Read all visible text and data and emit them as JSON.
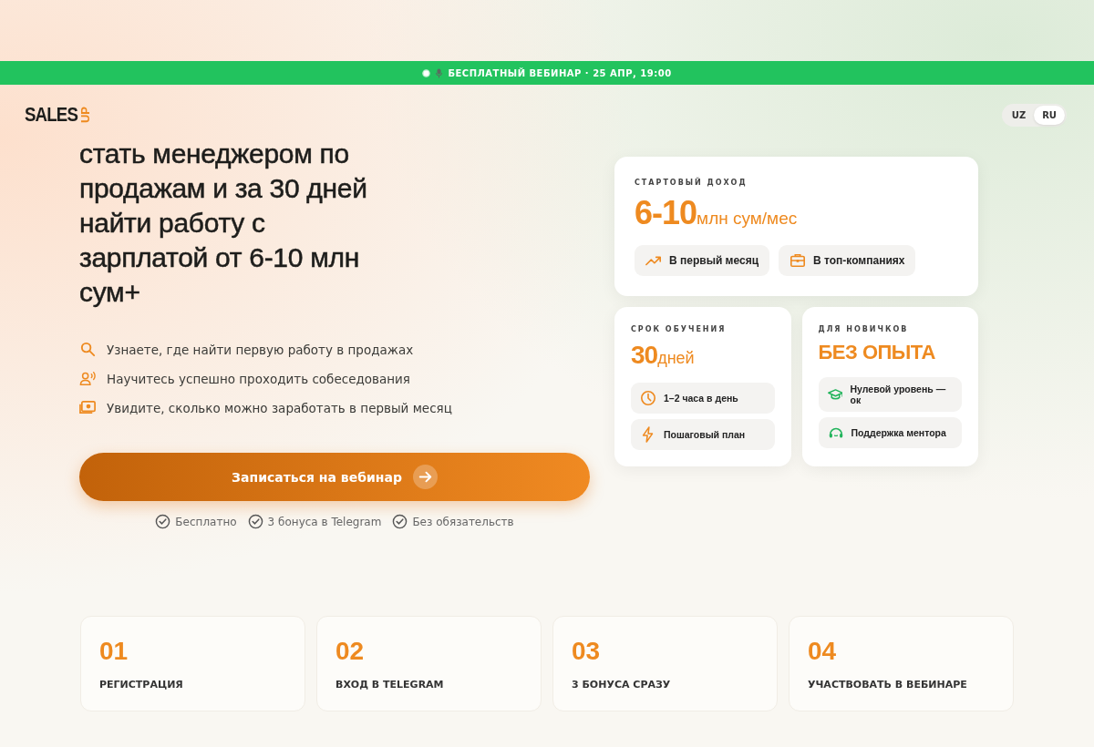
{
  "banner": {
    "text": "БЕСПЛАТНЫЙ ВЕБИНАР · 25 АПР, 19:00"
  },
  "logo": {
    "main": "SALES",
    "accent": "UP"
  },
  "languages": [
    {
      "label": "UZ",
      "selected": false
    },
    {
      "label": "RU",
      "selected": true
    }
  ],
  "headline": "стать менеджером по продажам и за 30 дней найти работу с зарплатой от 6-10 млн сум+",
  "benefits": [
    "Узнаете, где найти первую работу в продажах",
    "Научитесь успешно проходить собеседования",
    "Увидите, сколько можно заработать в первый месяц"
  ],
  "cta": {
    "label": "Записаться на вебинар"
  },
  "perks": [
    "Бесплатно",
    "3 бонуса в Telegram",
    "Без обязательств"
  ],
  "income": {
    "label": "СТАРТОВЫЙ ДОХОД",
    "value": "6-10",
    "unit": "млн сум/мес",
    "tags": [
      "В первый месяц",
      "В топ-компаниях"
    ]
  },
  "duration": {
    "label": "СРОК ОБУЧЕНИЯ",
    "value": "30",
    "unit": "дней",
    "tags": [
      "1–2 часа в день",
      "Пошаговый план"
    ]
  },
  "beginners": {
    "label": "ДЛЯ НОВИЧКОВ",
    "value": "БЕЗ ОПЫТА",
    "tags": [
      "Нулевой уровень — ок",
      "Поддержка ментора"
    ]
  },
  "steps": [
    {
      "number": "01",
      "title": "РЕГИСТРАЦИЯ"
    },
    {
      "number": "02",
      "title": "ВХОД В TELEGRAM"
    },
    {
      "number": "03",
      "title": "3 БОНУСА СРАЗУ"
    },
    {
      "number": "04",
      "title": "УЧАСТВОВАТЬ В ВЕБИНАРЕ"
    }
  ]
}
